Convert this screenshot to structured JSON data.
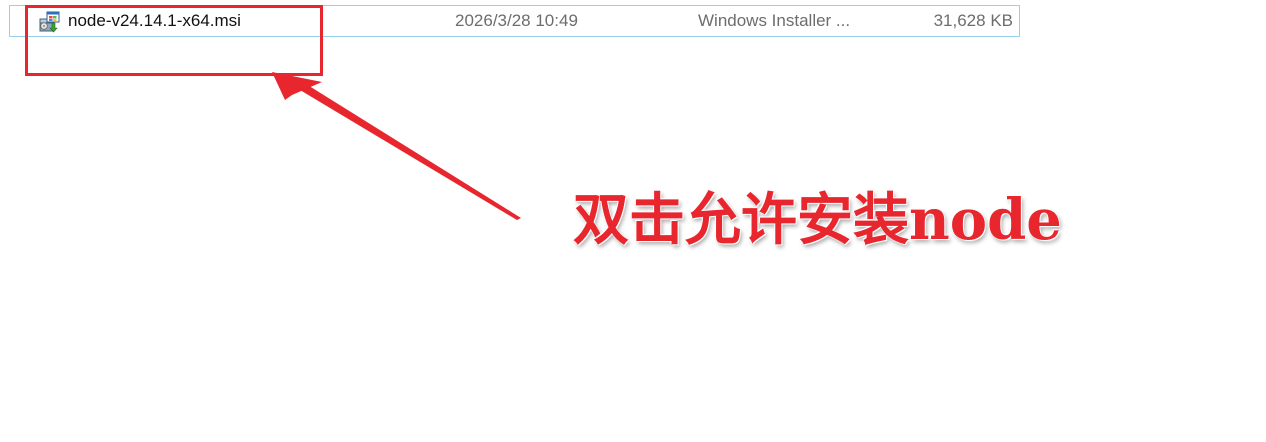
{
  "file_row": {
    "name": "node-v24.14.1-x64.msi",
    "date_modified": "2026/3/28 10:49",
    "type": "Windows Installer ...",
    "size": "31,628 KB",
    "icon": "msi-installer-icon"
  },
  "annotation": {
    "instruction": "双击允许安装node",
    "color": "#e8262e"
  },
  "colors": {
    "row_border": "#99d1ea",
    "secondary_text": "#6d6d6d"
  }
}
